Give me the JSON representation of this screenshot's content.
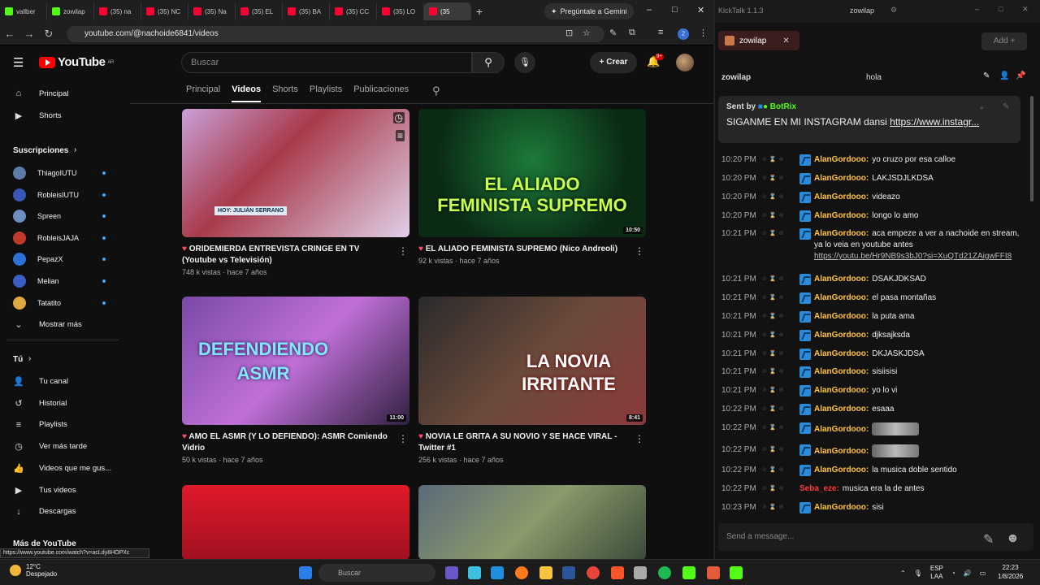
{
  "browser": {
    "tabs": [
      {
        "label": "vallber",
        "icon": "kick"
      },
      {
        "label": "zowilap",
        "icon": "kick"
      },
      {
        "label": "(35) na",
        "icon": "youtube"
      },
      {
        "label": "(35) NC",
        "icon": "youtube"
      },
      {
        "label": "(35) Na",
        "icon": "youtube"
      },
      {
        "label": "(35) EL",
        "icon": "youtube"
      },
      {
        "label": "(35) BA",
        "icon": "youtube"
      },
      {
        "label": "(35) CC",
        "icon": "youtube"
      },
      {
        "label": "(35) LO",
        "icon": "youtube"
      },
      {
        "label": "(35",
        "icon": "youtube"
      }
    ],
    "gemini_label": "Pregúntale a Gemini",
    "url": "youtube.com/@nachoide6841/videos",
    "status_url": "https://www.youtube.com/watch?v=acLdy8HOPXc",
    "profile_badge": "2"
  },
  "youtube": {
    "logo_text": "YouTube",
    "logo_region": "AR",
    "search_placeholder": "Buscar",
    "create_label": "Crear",
    "notif_count": "9+",
    "sidebar": {
      "main": [
        {
          "label": "Principal",
          "icon": "home-icon"
        },
        {
          "label": "Shorts",
          "icon": "shorts-icon"
        }
      ],
      "subs_header": "Suscripciones",
      "subs": [
        "ThiagoIUTU",
        "RobleisIUTU",
        "Spreen",
        "RobleisJAJA",
        "PepazX",
        "Melian",
        "Tatatito"
      ],
      "show_more": "Mostrar más",
      "you_header": "Tú",
      "you": [
        "Tu canal",
        "Historial",
        "Playlists",
        "Ver más tarde",
        "Videos que me gus...",
        "Tus videos",
        "Descargas"
      ],
      "more_header": "Más de YouTube"
    },
    "channel_tabs": [
      "Principal",
      "Videos",
      "Shorts",
      "Playlists",
      "Publicaciones"
    ],
    "active_tab": "Videos",
    "videos": [
      {
        "title": "ORIDEMIERDA ENTREVISTA CRINGE EN TV (Youtube vs Televisión)",
        "meta": "748 k vistas · hace 7 años",
        "duration": "",
        "overlay": "HOY: JULIÁN SERRANO"
      },
      {
        "title": "EL ALIADO FEMINISTA SUPREMO (Nico Andreoli)",
        "meta": "92 k vistas · hace 7 años",
        "duration": "10:50",
        "overlay": "EL ALIADO FEMINISTA SUPREMO"
      },
      {
        "title": "AMO EL ASMR (Y LO DEFIENDO): ASMR Comiendo Vidrio",
        "meta": "50 k vistas · hace 7 años",
        "duration": "11:00",
        "overlay": "DEFENDIENDO ASMR"
      },
      {
        "title": "NOVIA LE GRITA A SU NOVIO Y SE HACE VIRAL - Twitter #1",
        "meta": "256 k vistas · hace 7 años",
        "duration": "8:41",
        "overlay": "LA NOVIA IRRITANTE"
      }
    ]
  },
  "kicktalk": {
    "app_title": "KickTalk 1.1.3",
    "window_channel": "zowilap",
    "channel_tab": "zowilap",
    "add_label": "Add",
    "chat_channel": "zowilap",
    "chat_user_field": "hola",
    "pinned": {
      "sent_by": "Sent by",
      "bot": "BotRix",
      "message": "SIGANME EN MI INSTAGRAM dansi",
      "link": "https://www.instagr..."
    },
    "messages": [
      {
        "time": "10:20 PM",
        "user": "AlanGordooo:",
        "text": "yo cruzo por esa calloe"
      },
      {
        "time": "10:20 PM",
        "user": "AlanGordooo:",
        "text": "LAKJSDJLKDSA"
      },
      {
        "time": "10:20 PM",
        "user": "AlanGordooo:",
        "text": "videazo"
      },
      {
        "time": "10:20 PM",
        "user": "AlanGordooo:",
        "text": "longo lo amo"
      },
      {
        "time": "10:21 PM",
        "user": "AlanGordooo:",
        "text": "aca empeze a ver a nachoide en stream, ya lo veia en youtube antes",
        "link": "https://youtu.be/Hr9NB9s3bJ0?si=XuQTd21ZAigwFFI8"
      },
      {
        "time": "10:21 PM",
        "user": "AlanGordooo:",
        "text": "DSAKJDKSAD"
      },
      {
        "time": "10:21 PM",
        "user": "AlanGordooo:",
        "text": "el pasa montañas"
      },
      {
        "time": "10:21 PM",
        "user": "AlanGordooo:",
        "text": "la puta ama"
      },
      {
        "time": "10:21 PM",
        "user": "AlanGordooo:",
        "text": "djksajksda"
      },
      {
        "time": "10:21 PM",
        "user": "AlanGordooo:",
        "text": "DKJASKJDSA"
      },
      {
        "time": "10:21 PM",
        "user": "AlanGordooo:",
        "text": "sisiisisi"
      },
      {
        "time": "10:21 PM",
        "user": "AlanGordooo:",
        "text": "yo lo vi"
      },
      {
        "time": "10:22 PM",
        "user": "AlanGordooo:",
        "text": "esaaa"
      },
      {
        "time": "10:22 PM",
        "user": "AlanGordooo:",
        "text": "",
        "emote": true
      },
      {
        "time": "10:22 PM",
        "user": "AlanGordooo:",
        "text": "",
        "emote": true
      },
      {
        "time": "10:22 PM",
        "user": "AlanGordooo:",
        "text": "la musica doble sentido"
      },
      {
        "time": "10:22 PM",
        "user": "Seba_eze:",
        "text": "musica era la de antes",
        "red": true
      },
      {
        "time": "10:23 PM",
        "user": "AlanGordooo:",
        "text": "sisi"
      }
    ],
    "input_placeholder": "Send a message..."
  },
  "taskbar": {
    "temp": "12°C",
    "weather": "Despejado",
    "search": "Buscar",
    "lang": "ESP",
    "lang2": "LAA",
    "time": "22:23",
    "date": "1/8/2026"
  }
}
